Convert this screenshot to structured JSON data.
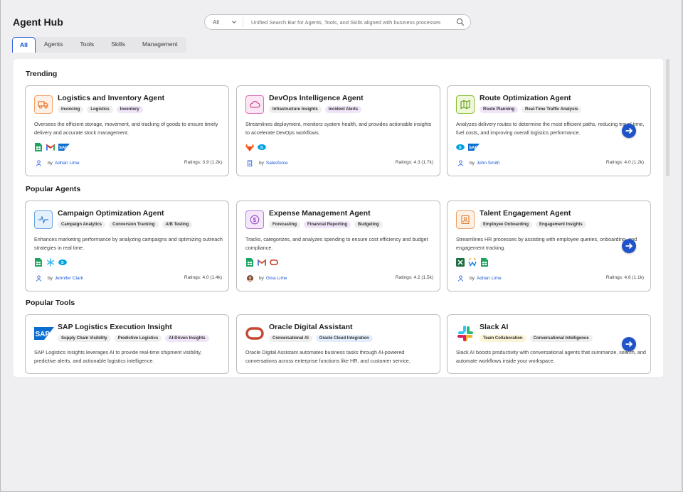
{
  "header": {
    "title": "Agent Hub"
  },
  "search": {
    "category": "All",
    "placeholder": "Unified Search Bar for Agents, Tools, and Skills aligned with business processes"
  },
  "tabs": [
    {
      "label": "All",
      "active": true
    },
    {
      "label": "Agents"
    },
    {
      "label": "Tools"
    },
    {
      "label": "Skills"
    },
    {
      "label": "Management"
    }
  ],
  "sections": {
    "trending": {
      "title": "Trending",
      "cards": [
        {
          "name": "Logistics and Inventory Agent",
          "icon": "truck-icon",
          "tags": [
            "Invoicing",
            "Logistics",
            "Inventory"
          ],
          "description": "Oversees the efficient storage, movement, and tracking of goods to ensure timely delivery and accurate stock management.",
          "logos": [
            "google-sheets-icon",
            "gmail-icon",
            "sap-icon"
          ],
          "by": "by",
          "author": "Adrian Lime",
          "rating": "Ratings: 3.9 (1.2k)"
        },
        {
          "name": "DevOps Intelligence Agent",
          "icon": "cloud-icon",
          "tags": [
            "Infrastructure Insights",
            "Incident Alerts"
          ],
          "description": "Streamlines deployment, monitors system health, and provides actionable insights to accelerate DevOps workflows.",
          "logos": [
            "gitlab-icon",
            "salesforce-icon"
          ],
          "by": "by",
          "author": "Salesforce",
          "rating": "Ratings: 4.3 (1.7k)"
        },
        {
          "name": "Route Optimization Agent",
          "icon": "map-icon",
          "tags": [
            "Route Planning",
            "Real-Time Traffic Analysis"
          ],
          "description": "Analyzes delivery routes to determine the most efficient paths, reducing travel time, fuel costs, and improving overall logistics performance.",
          "logos": [
            "salesforce-icon",
            "sap-icon"
          ],
          "by": "by",
          "author": "John Smith",
          "rating": "Ratings: 4.0 (1.2k)"
        }
      ]
    },
    "popular_agents": {
      "title": "Popular Agents",
      "cards": [
        {
          "name": "Campaign Optimization Agent",
          "icon": "pulse-icon",
          "tags": [
            "Campaign Analytics",
            "Conversion Tracking",
            "A/B Testing"
          ],
          "description": "Enhances marketing performance by analyzing campaigns and optimizing outreach strategies in real time.",
          "logos": [
            "google-sheets-icon",
            "snowflake-icon",
            "salesforce-icon"
          ],
          "by": "by",
          "author": "Jennifer Clark",
          "rating": "Ratings: 4.0 (1.4k)"
        },
        {
          "name": "Expense Management Agent",
          "icon": "dollar-icon",
          "tags": [
            "Forecasting",
            "Financial Reporting",
            "Budgeting"
          ],
          "description": "Tracks, categorizes, and analyzes spending to ensure cost efficiency and budget compliance.",
          "logos": [
            "google-sheets-icon",
            "gmail-icon",
            "oracle-icon"
          ],
          "by": "by",
          "author": "Gina Lime",
          "rating": "Ratings: 4.2 (1.5k)"
        },
        {
          "name": "Talent Engagement Agent",
          "icon": "id-badge-icon",
          "tags": [
            "Employee Onboarding",
            "Engagement Insights"
          ],
          "description": "Streamlines HR processes by assisting with employee queries, onboarding, and engagement tracking.",
          "logos": [
            "excel-icon",
            "workday-icon",
            "google-sheets-icon"
          ],
          "by": "by",
          "author": "Adrian Lime",
          "rating": "Ratings: 4.6 (1.1k)"
        }
      ]
    },
    "popular_tools": {
      "title": "Popular Tools",
      "cards": [
        {
          "name": "SAP Logistics Execution Insight",
          "icon": "sap-logo",
          "tags": [
            "Supply Chain Visibility",
            "Predictive Logistics",
            "AI-Driven Insights"
          ],
          "description": "SAP Logistics Insights leverages AI to provide real-time shipment visibility, predictive alerts, and actionable logistics intelligence."
        },
        {
          "name": "Oracle Digital Assistant",
          "icon": "oracle-logo",
          "tags": [
            "Conversational AI",
            "Oracle Cloud Integration"
          ],
          "description": "Oracle Digital Assistant automates business tasks through AI-powered conversations across enterprise functions like HR, and customer service."
        },
        {
          "name": "Slack AI",
          "icon": "slack-logo",
          "tags": [
            "Team Collaboration",
            "Conversational Intelligence"
          ],
          "description": "Slack AI boosts productivity with conversational agents that summarize, search, and automate workflows inside your workspace."
        }
      ]
    }
  },
  "colors": {
    "accent": "#1f53c9",
    "link": "#1a57d6"
  }
}
